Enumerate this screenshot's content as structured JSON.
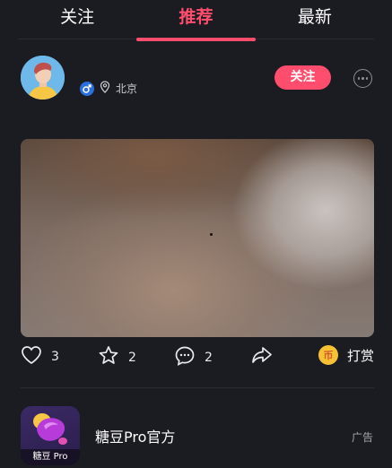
{
  "tabs": [
    {
      "label": "关注"
    },
    {
      "label": "推荐"
    },
    {
      "label": "最新"
    }
  ],
  "post": {
    "location": "北京",
    "follow_label": "关注"
  },
  "actions": {
    "likes": "3",
    "favorites": "2",
    "comments": "2",
    "reward_coin": "币",
    "reward_label": "打赏"
  },
  "ad": {
    "name": "糖豆Pro官方",
    "logo_caption": "糖豆 Pro",
    "tag": "广告"
  },
  "colors": {
    "accent": "#ff4d6d",
    "background": "#1b1b22",
    "gender_badge": "#2a6fe0",
    "coin": "#f6c234"
  }
}
